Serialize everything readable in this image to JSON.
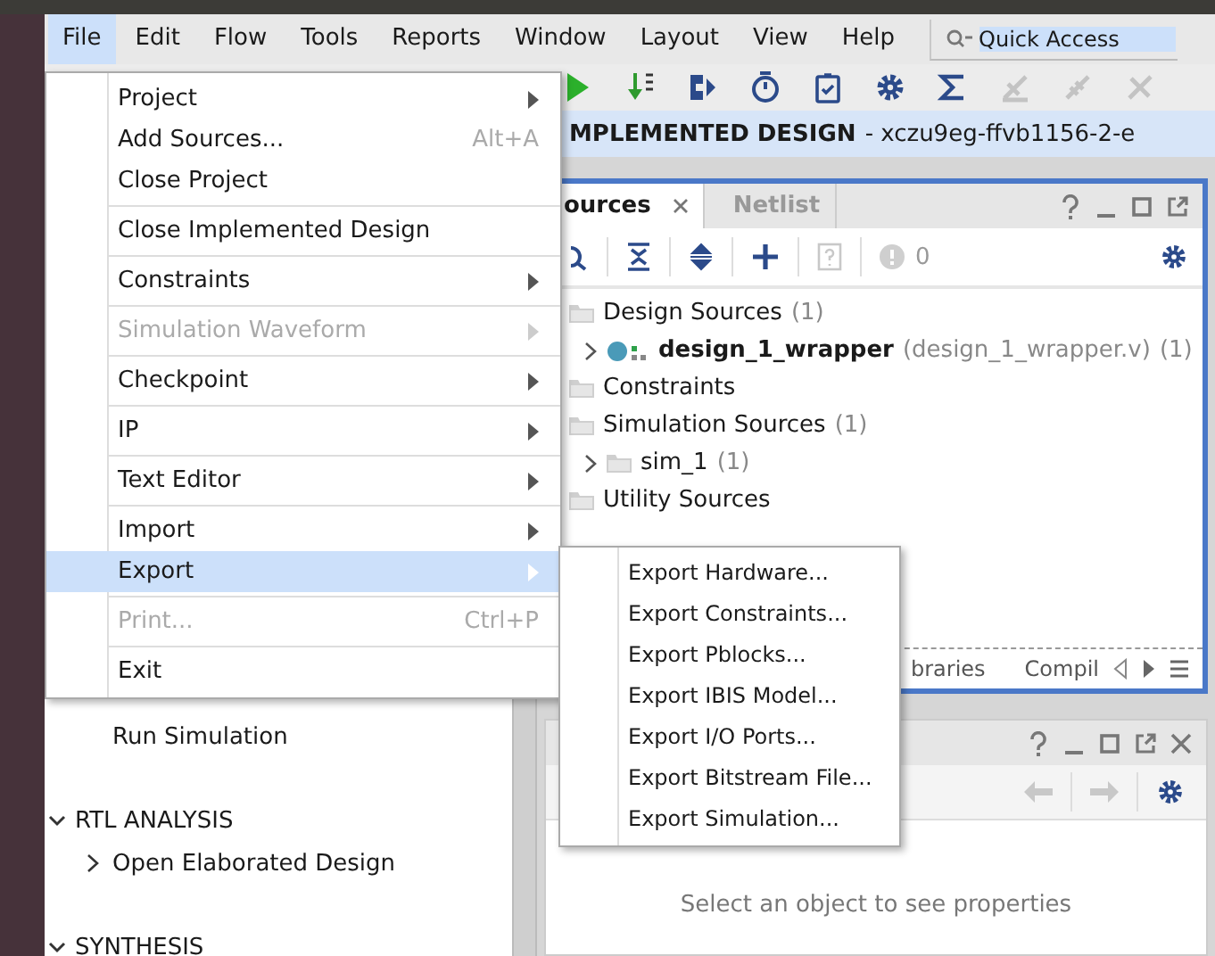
{
  "menu_bar": [
    {
      "label": "File",
      "selected": true
    },
    {
      "label": "Edit",
      "selected": false
    },
    {
      "label": "Flow",
      "selected": false
    },
    {
      "label": "Tools",
      "selected": false
    },
    {
      "label": "Reports",
      "selected": false
    },
    {
      "label": "Window",
      "selected": false
    },
    {
      "label": "Layout",
      "selected": false
    },
    {
      "label": "View",
      "selected": false
    },
    {
      "label": "Help",
      "selected": false
    }
  ],
  "quick_access": {
    "placeholder": "Quick Access"
  },
  "banner": {
    "title": "MPLEMENTED DESIGN",
    "part": "- xczu9eg-ffvb1156-2-e"
  },
  "flow_navigator": [
    {
      "kind": "item",
      "label": "Run Simulation"
    },
    {
      "kind": "section",
      "label": "RTL ANALYSIS",
      "expanded": true
    },
    {
      "kind": "item",
      "label": "Open Elaborated Design",
      "expandable": true
    },
    {
      "kind": "section",
      "label": "SYNTHESIS",
      "expanded": true
    }
  ],
  "sources_panel": {
    "tabs": [
      {
        "label": "ources",
        "selected": true,
        "closable": true
      },
      {
        "label": "Netlist",
        "selected": false,
        "closable": false
      }
    ],
    "error_count": "0",
    "tree": [
      {
        "label": "Design Sources",
        "count": "(1)",
        "children": [
          {
            "kind": "module",
            "label": "design_1_wrapper",
            "file": "(design_1_wrapper.v)",
            "count": "(1)",
            "expanded": false
          }
        ]
      },
      {
        "label": "Constraints"
      },
      {
        "label": "Simulation Sources",
        "count": "(1)",
        "children": [
          {
            "kind": "folder",
            "label": "sim_1",
            "count": "(1)",
            "expanded": false
          }
        ]
      },
      {
        "label": "Utility Sources"
      }
    ],
    "bottom_tabs": [
      {
        "label": "braries"
      },
      {
        "label": "Compil"
      }
    ]
  },
  "properties_panel": {
    "message": "Select an object to see properties"
  },
  "file_menu": [
    {
      "kind": "item",
      "label": "Project",
      "submenu": true,
      "disabled": false,
      "selected": false
    },
    {
      "kind": "item",
      "label": "Add Sources...",
      "shortcut": "Alt+A",
      "disabled": false,
      "selected": false
    },
    {
      "kind": "item",
      "label": "Close Project",
      "disabled": false,
      "selected": false
    },
    {
      "kind": "separator"
    },
    {
      "kind": "item",
      "label": "Close Implemented Design",
      "disabled": false,
      "selected": false
    },
    {
      "kind": "separator"
    },
    {
      "kind": "item",
      "label": "Constraints",
      "submenu": true,
      "disabled": false,
      "selected": false
    },
    {
      "kind": "separator"
    },
    {
      "kind": "item",
      "label": "Simulation Waveform",
      "submenu": true,
      "disabled": true,
      "selected": false
    },
    {
      "kind": "separator"
    },
    {
      "kind": "item",
      "label": "Checkpoint",
      "submenu": true,
      "disabled": false,
      "selected": false
    },
    {
      "kind": "separator"
    },
    {
      "kind": "item",
      "label": "IP",
      "submenu": true,
      "disabled": false,
      "selected": false
    },
    {
      "kind": "separator"
    },
    {
      "kind": "item",
      "label": "Text Editor",
      "submenu": true,
      "disabled": false,
      "selected": false
    },
    {
      "kind": "separator"
    },
    {
      "kind": "item",
      "label": "Import",
      "submenu": true,
      "disabled": false,
      "selected": false
    },
    {
      "kind": "item",
      "label": "Export",
      "submenu": true,
      "disabled": false,
      "selected": true
    },
    {
      "kind": "separator"
    },
    {
      "kind": "item",
      "label": "Print...",
      "shortcut": "Ctrl+P",
      "disabled": true,
      "selected": false
    },
    {
      "kind": "separator"
    },
    {
      "kind": "item",
      "label": "Exit",
      "disabled": false,
      "selected": false
    }
  ],
  "export_submenu": [
    "Export Hardware...",
    "Export Constraints...",
    "Export Pblocks...",
    "Export IBIS Model...",
    "Export I/O Ports...",
    "Export Bitstream File...",
    "Export Simulation..."
  ]
}
